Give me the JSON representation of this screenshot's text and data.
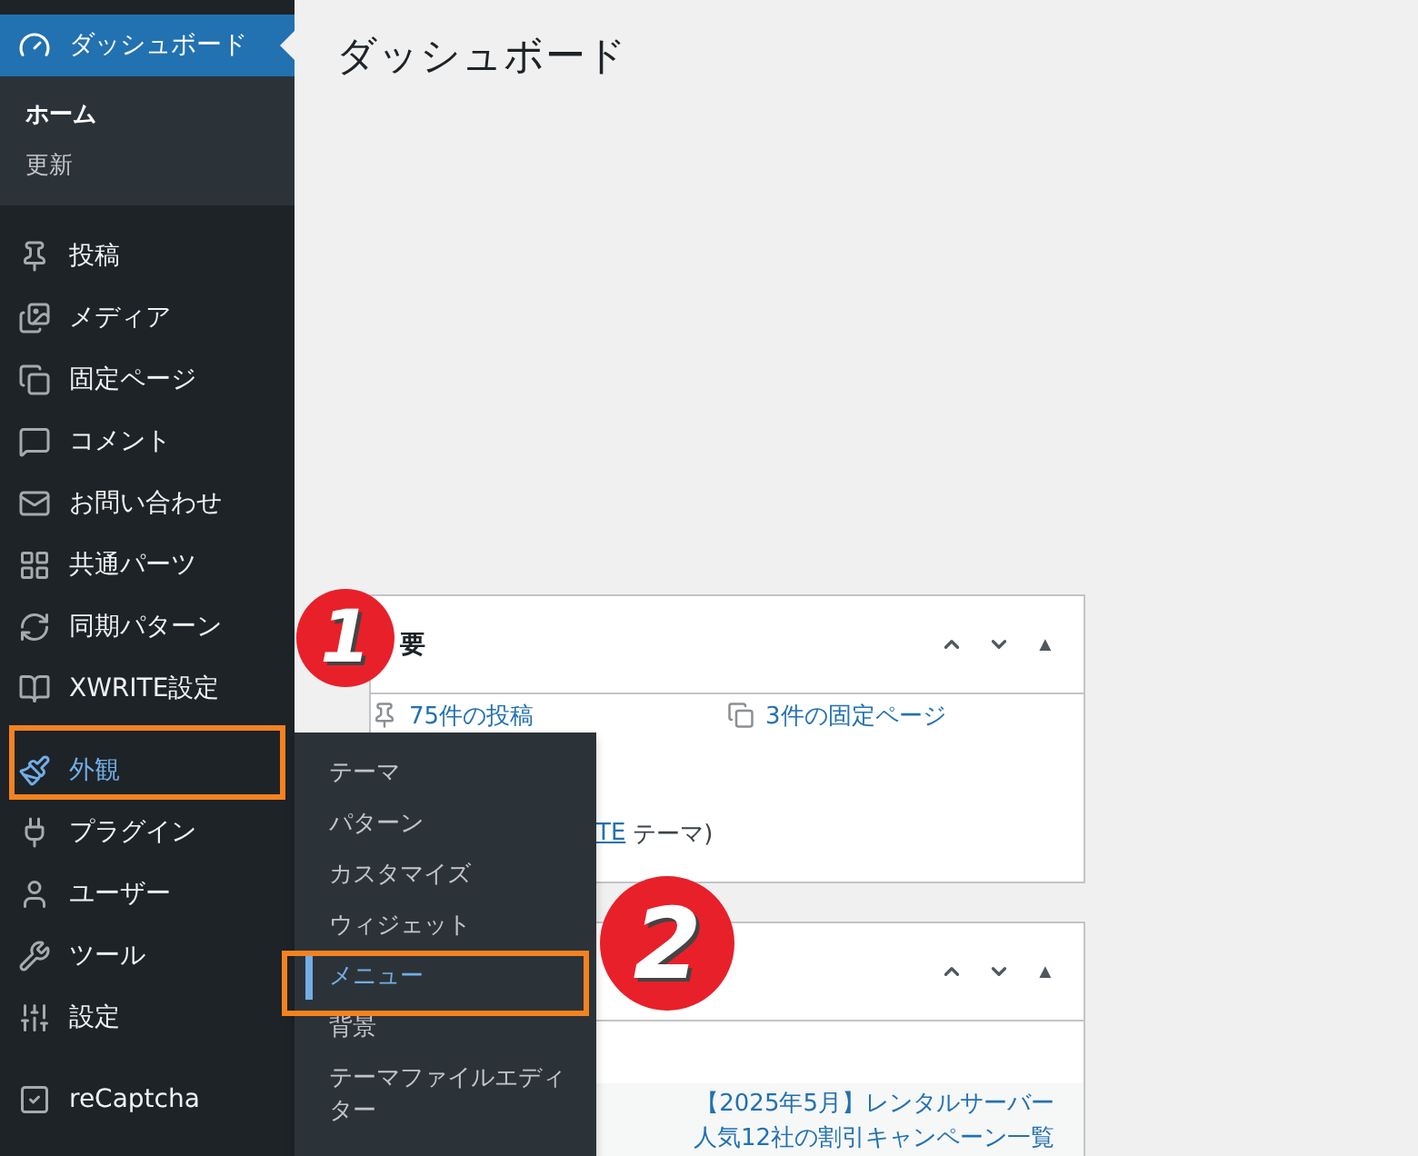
{
  "sidebar": {
    "groups": [
      [
        {
          "label": "ダッシュボード",
          "selected": true,
          "hovered": false,
          "children": [
            {
              "label": "ホーム",
              "selected": true
            },
            {
              "label": "更新",
              "selected": false
            }
          ]
        }
      ],
      [
        {
          "label": "投稿",
          "selected": false,
          "hovered": false
        },
        {
          "label": "メディア",
          "selected": false,
          "hovered": false
        },
        {
          "label": "固定ページ",
          "selected": false,
          "hovered": false
        },
        {
          "label": "コメント",
          "selected": false,
          "hovered": false
        },
        {
          "label": "お問い合わせ",
          "selected": false,
          "hovered": false
        },
        {
          "label": "共通パーツ",
          "selected": false,
          "hovered": false
        },
        {
          "label": "同期パターン",
          "selected": false,
          "hovered": false
        },
        {
          "label": "XWRITE設定",
          "selected": false,
          "hovered": false
        }
      ],
      [
        {
          "label": "外観",
          "selected": false,
          "hovered": true
        },
        {
          "label": "プラグイン",
          "selected": false,
          "hovered": false
        },
        {
          "label": "ユーザー",
          "selected": false,
          "hovered": false
        },
        {
          "label": "ツール",
          "selected": false,
          "hovered": false
        },
        {
          "label": "設定",
          "selected": false,
          "hovered": false
        }
      ],
      [
        {
          "label": "reCaptcha",
          "selected": false,
          "hovered": false
        }
      ]
    ]
  },
  "page_title": "ダッシュボード",
  "cards": [
    {
      "title": "要",
      "toggle": "▲",
      "rows": [
        {
          "kind": "pair",
          "left": "75件の投稿",
          "right": "3件の固定ページ"
        },
        {
          "kind": "theme",
          "link": "TE",
          "text": "テーマ)"
        }
      ]
    },
    {
      "toggle": "▲",
      "rows": [
        {
          "kind": "news",
          "link": "【2025年5月】レンタルサーバー人気12社の割引キャンペーン一覧"
        }
      ]
    }
  ],
  "flyout": {
    "items": [
      {
        "label": "テーマ",
        "selected": false
      },
      {
        "label": "パターン",
        "selected": false
      },
      {
        "label": "カスタマイズ",
        "selected": false
      },
      {
        "label": "ウィジェット",
        "selected": false
      },
      {
        "label": "メニュー",
        "selected": true
      },
      {
        "label": "背景",
        "selected": false
      },
      {
        "label": "テーマファイルエディター",
        "selected": false
      }
    ]
  },
  "annotations": [
    {
      "number": "1"
    },
    {
      "number": "2"
    }
  ]
}
